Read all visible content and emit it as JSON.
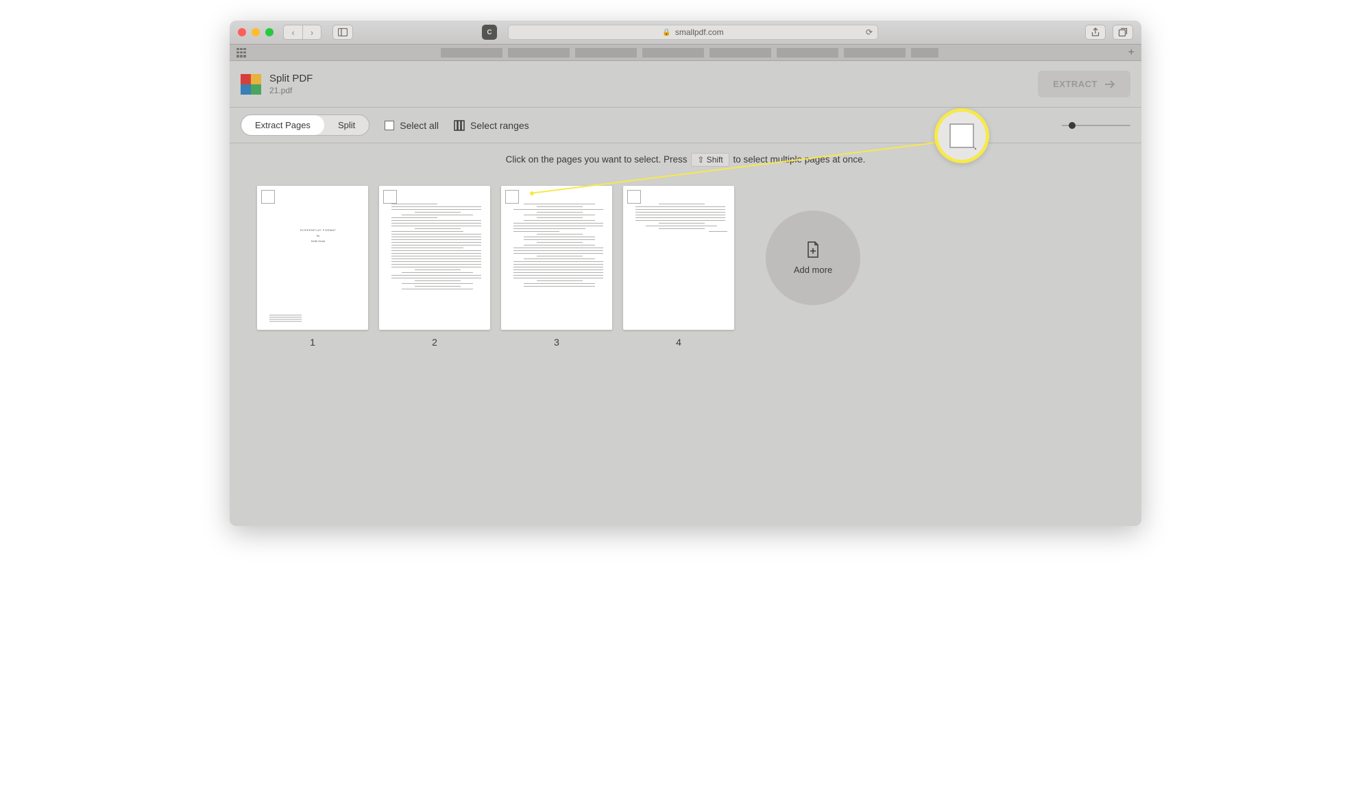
{
  "browser": {
    "url_host": "smallpdf.com",
    "lock": "🔒"
  },
  "header": {
    "title": "Split PDF",
    "filename": "21.pdf"
  },
  "extract_button": "EXTRACT",
  "segmented": {
    "extract_pages": "Extract Pages",
    "split": "Split"
  },
  "options": {
    "select_all": "Select all",
    "select_ranges": "Select ranges"
  },
  "instruction": {
    "before": "Click on the pages you want to select. Press",
    "key": "⇧  Shift",
    "after": "to select multiple pages at once."
  },
  "pages": [
    {
      "num": "1"
    },
    {
      "num": "2"
    },
    {
      "num": "3"
    },
    {
      "num": "4"
    }
  ],
  "add_more": "Add more"
}
